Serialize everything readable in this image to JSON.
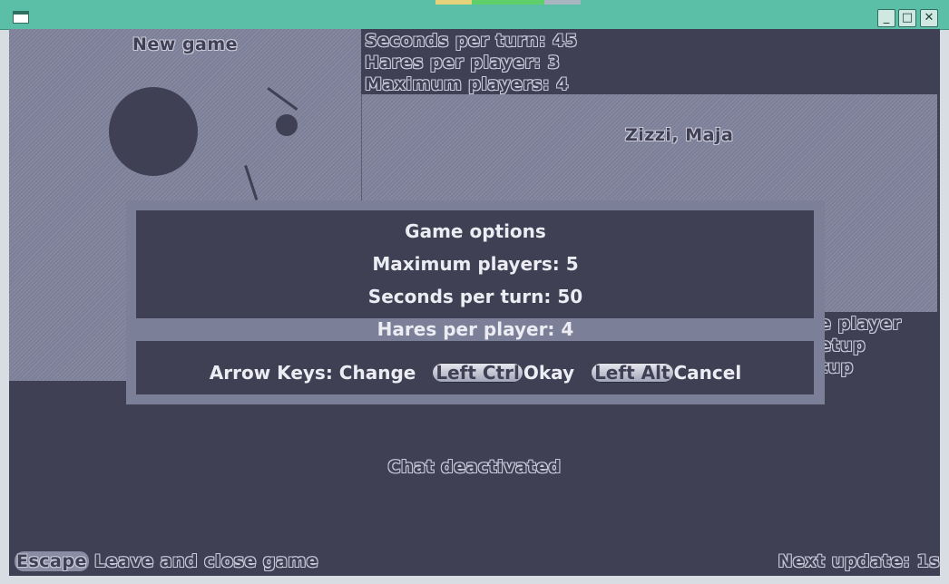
{
  "window": {
    "buttons": {
      "minimize": "_",
      "maximize": "□",
      "close": "✕"
    }
  },
  "game": {
    "map": {
      "title": "New game"
    },
    "info": {
      "seconds_per_turn": "Seconds per turn: 45",
      "hares_per_player": "Hares per player: 3",
      "max_players": "Maximum players: 4"
    },
    "players": [
      "Zizzi, Maja"
    ],
    "menu_partial": [
      "e player",
      "etup",
      "tup"
    ],
    "chat_status": "Chat deactivated",
    "footer": {
      "escape_key": "Escape",
      "escape_label": "Leave and close game",
      "next_update": "Next update: 1s"
    }
  },
  "dialog": {
    "title": "Game options",
    "max_players": "Maximum players: 5",
    "seconds_per_turn": "Seconds per turn: 50",
    "hares_per_player": "Hares per player: 4",
    "arrow_hint": "Arrow Keys: Change",
    "ok_key": "Left Ctrl",
    "ok_label": "Okay",
    "cancel_key": "Left Alt",
    "cancel_label": "Cancel"
  },
  "colors": {
    "titlebar": "#5bbfa8",
    "background": "#404055",
    "panel": "#7c7f98",
    "text_light": "#ececf3"
  }
}
